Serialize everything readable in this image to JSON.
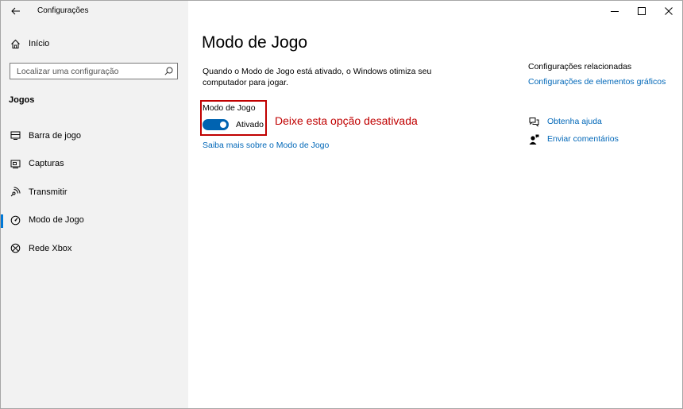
{
  "window": {
    "title": "Configurações",
    "controls": {
      "minimize": "minimize-icon",
      "maximize": "maximize-icon",
      "close": "close-icon"
    }
  },
  "sidebar": {
    "home_label": "Início",
    "search": {
      "placeholder": "Localizar uma configuração",
      "value": ""
    },
    "section_heading": "Jogos",
    "items": [
      {
        "label": "Barra de jogo",
        "icon": "game-bar-icon",
        "selected": false
      },
      {
        "label": "Capturas",
        "icon": "captures-icon",
        "selected": false
      },
      {
        "label": "Transmitir",
        "icon": "broadcast-icon",
        "selected": false
      },
      {
        "label": "Modo de Jogo",
        "icon": "game-mode-icon",
        "selected": true
      },
      {
        "label": "Rede Xbox",
        "icon": "xbox-icon",
        "selected": false
      }
    ]
  },
  "main": {
    "title": "Modo de Jogo",
    "description": "Quando o Modo de Jogo está ativado, o Windows otimiza seu computador para jogar.",
    "toggle": {
      "label": "Modo de Jogo",
      "state_text": "Ativado",
      "on": true
    },
    "annotation": "Deixe esta opção desativada",
    "learn_more": "Saiba mais sobre o Modo de Jogo"
  },
  "related": {
    "heading": "Configurações relacionadas",
    "link": "Configurações de elementos gráficos",
    "help": "Obtenha ajuda",
    "feedback": "Enviar comentários"
  },
  "colors": {
    "accent": "#0078d7",
    "toggle_on": "#0063b1",
    "link": "#0067b8",
    "annotation": "#c00000",
    "sidebar_bg": "#f2f2f2"
  }
}
